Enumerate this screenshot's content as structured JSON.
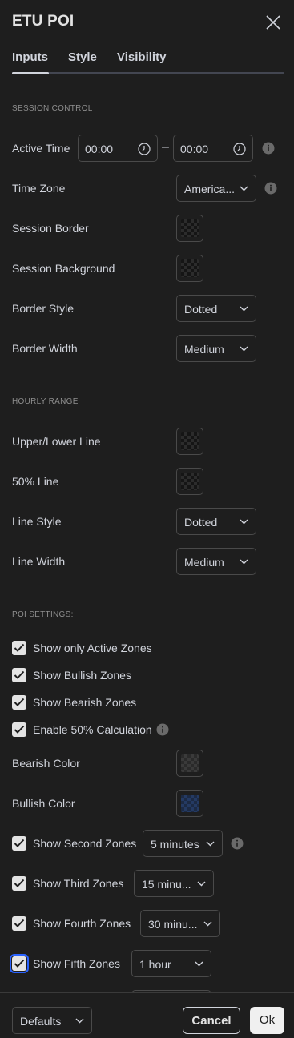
{
  "dialog": {
    "title": "ETU POI",
    "close_icon": "close-icon"
  },
  "tabs": [
    {
      "label": "Inputs",
      "active": true
    },
    {
      "label": "Style",
      "active": false
    },
    {
      "label": "Visibility",
      "active": false
    }
  ],
  "session_control": {
    "heading": "SESSION CONTROL",
    "active_time": {
      "label": "Active Time",
      "start": "00:00",
      "end": "00:00",
      "separator": "–"
    },
    "time_zone": {
      "label": "Time Zone",
      "value": "America..."
    },
    "session_border": {
      "label": "Session Border"
    },
    "session_background": {
      "label": "Session Background"
    },
    "border_style": {
      "label": "Border Style",
      "value": "Dotted"
    },
    "border_width": {
      "label": "Border Width",
      "value": "Medium"
    }
  },
  "hourly_range": {
    "heading": "HOURLY RANGE",
    "upper_lower_line": {
      "label": "Upper/Lower Line"
    },
    "fifty_line": {
      "label": "50% Line"
    },
    "line_style": {
      "label": "Line Style",
      "value": "Dotted"
    },
    "line_width": {
      "label": "Line Width",
      "value": "Medium"
    }
  },
  "poi_settings": {
    "heading": "POI SETTINGS:",
    "show_only_active": {
      "label": "Show only Active Zones",
      "checked": true
    },
    "show_bullish": {
      "label": "Show Bullish Zones",
      "checked": true
    },
    "show_bearish": {
      "label": "Show Bearish Zones",
      "checked": true
    },
    "enable_50": {
      "label": "Enable 50% Calculation",
      "checked": true
    },
    "bearish_color": {
      "label": "Bearish Color"
    },
    "bullish_color": {
      "label": "Bullish Color"
    },
    "second_zones": {
      "label": "Show Second Zones",
      "checked": true,
      "value": "5 minutes"
    },
    "third_zones": {
      "label": "Show Third Zones",
      "checked": true,
      "value": "15 minu..."
    },
    "fourth_zones": {
      "label": "Show Fourth Zones",
      "checked": true,
      "value": "30 minu..."
    },
    "fifth_zones": {
      "label": "Show Fifth Zones",
      "checked": true,
      "value": "1 hour"
    }
  },
  "footer": {
    "defaults": "Defaults",
    "cancel": "Cancel",
    "ok": "Ok"
  },
  "colors": {
    "background": "#1e1e1e",
    "text": "#d1d4dc",
    "border": "#4a4a4a",
    "focus": "#2962ff"
  }
}
